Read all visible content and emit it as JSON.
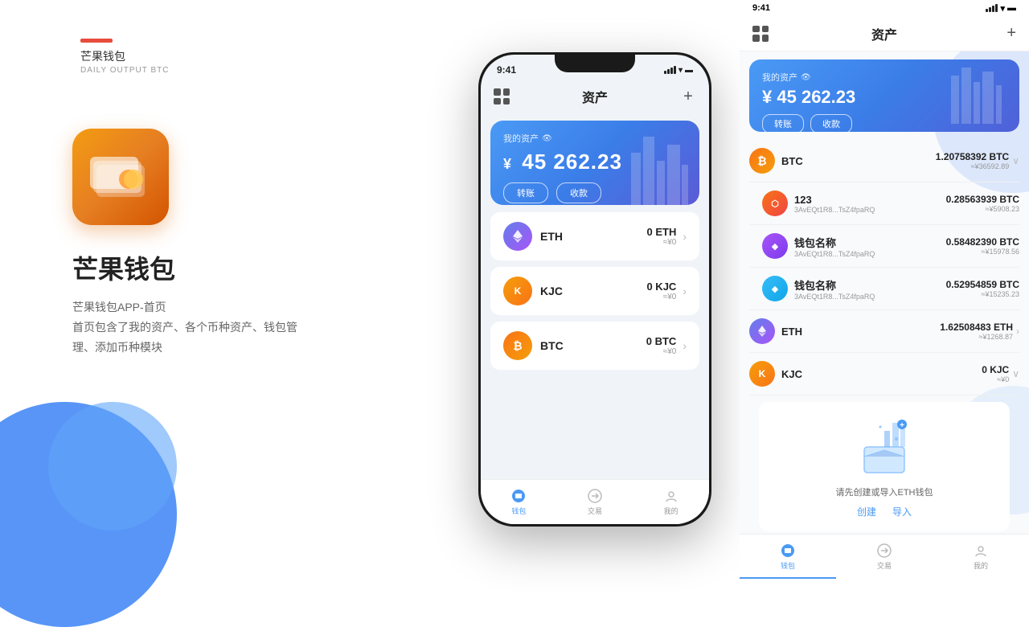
{
  "left": {
    "brand_bar": "━━",
    "app_name_small": "芒果钱包",
    "app_subtitle": "DAILY OUTPUT BTC",
    "app_name_large": "芒果钱包",
    "desc_line1": "芒果钱包APP-首页",
    "desc_line2": "首页包含了我的资产、各个币种资产、钱包管",
    "desc_line3": "理、添加币种模块"
  },
  "phone": {
    "status_time": "9:41",
    "header_title": "资产",
    "asset_label": "我的资产",
    "asset_amount": "45 262.23",
    "asset_yuan": "¥",
    "btn_transfer": "转账",
    "btn_receive": "收款",
    "coins": [
      {
        "symbol": "ETH",
        "name": "ETH",
        "amount": "0 ETH",
        "approx": "≈¥0",
        "type": "eth"
      },
      {
        "symbol": "KJC",
        "name": "KJC",
        "amount": "0 KJC",
        "approx": "≈¥0",
        "type": "kjc"
      },
      {
        "symbol": "BTC",
        "name": "BTC",
        "amount": "0 BTC",
        "approx": "≈¥0",
        "type": "btc"
      }
    ],
    "nav": [
      {
        "label": "钱包",
        "active": true
      },
      {
        "label": "交易",
        "active": false
      },
      {
        "label": "我的",
        "active": false
      }
    ]
  },
  "right": {
    "status_time": "9:41",
    "header_title": "资产",
    "asset_label": "我的资产",
    "asset_amount": "45 262.23",
    "asset_yuan": "¥",
    "btn_transfer": "转账",
    "btn_receive": "收款",
    "coins": [
      {
        "name": "BTC",
        "addr": "",
        "amount": "1.20758392 BTC",
        "approx": "≈¥36592.89",
        "type": "btc",
        "expandable": true
      },
      {
        "name": "123",
        "addr": "3AvEQt1R8...TsZ4fpaRQ",
        "amount": "0.28563939 BTC",
        "approx": "≈¥5908.23",
        "type": "orange",
        "expandable": false
      },
      {
        "name": "钱包名称",
        "addr": "3AvEQt1R8...TsZ4fpaRQ",
        "amount": "0.58482390 BTC",
        "approx": "≈¥15978.56",
        "type": "purple",
        "expandable": false
      },
      {
        "name": "钱包名称",
        "addr": "3AvEQt1R8...TsZ4fpaRQ",
        "amount": "0.52954859 BTC",
        "approx": "≈¥15235.23",
        "type": "blue_d",
        "expandable": false
      },
      {
        "name": "ETH",
        "addr": "",
        "amount": "1.62508483 ETH",
        "approx": "≈¥1268.87",
        "type": "eth",
        "expandable": true
      },
      {
        "name": "KJC",
        "addr": "",
        "amount": "0 KJC",
        "approx": "≈¥0",
        "type": "kjc",
        "expandable": true
      }
    ],
    "eth_create_text": "请先创建或导入ETH钱包",
    "eth_create_btn": "创建",
    "eth_import_btn": "导入",
    "nav": [
      {
        "label": "钱包",
        "active": true
      },
      {
        "label": "交易",
        "active": false
      },
      {
        "label": "我的",
        "active": false
      }
    ]
  }
}
